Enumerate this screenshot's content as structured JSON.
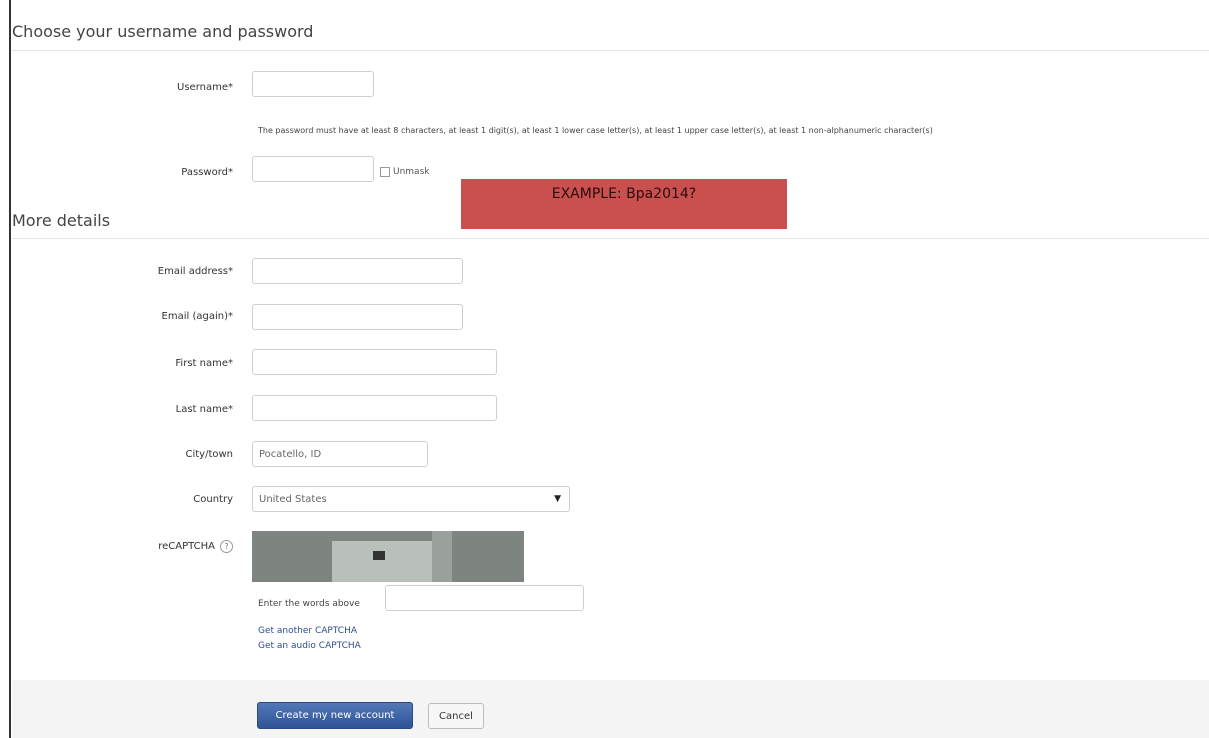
{
  "section1": {
    "title": "Choose your username and password",
    "username_label": "Username*",
    "password_policy": "The password must have at least 8 characters, at least 1 digit(s), at least 1 lower case letter(s), at least 1 upper case letter(s), at least 1 non-alphanumeric character(s)",
    "password_label": "Password*",
    "unmask_label": "Unmask"
  },
  "example_banner": "EXAMPLE: Bpa2014?",
  "section2": {
    "title": "More details",
    "email_label": "Email address*",
    "email_again_label": "Email (again)*",
    "first_name_label": "First name*",
    "last_name_label": "Last name*",
    "city_label": "City/town",
    "city_value": "Pocatello, ID",
    "country_label": "Country",
    "country_value": "United States",
    "recaptcha_label": "reCAPTCHA",
    "captcha_prompt": "Enter the words above",
    "another_captcha": "Get another CAPTCHA",
    "audio_captcha": "Get an audio CAPTCHA"
  },
  "buttons": {
    "create": "Create my new account",
    "cancel": "Cancel"
  },
  "colors": {
    "example_banner": "#c9504f",
    "primary_button": "#2f5497",
    "link": "#2f4d8f"
  }
}
